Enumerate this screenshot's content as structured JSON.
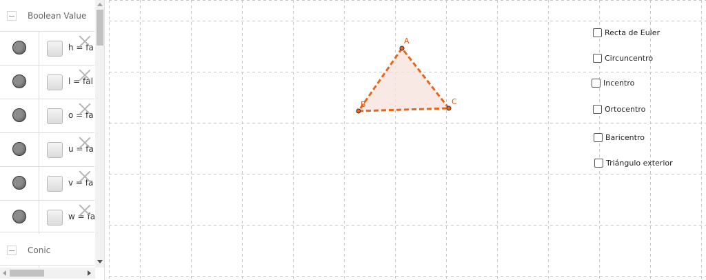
{
  "algebra": {
    "categories": [
      {
        "label": "Boolean Value"
      },
      {
        "label": "Conic"
      }
    ],
    "boolean_rows": [
      {
        "text": "h = fa"
      },
      {
        "text": "l = fal"
      },
      {
        "text": "o = fa"
      },
      {
        "text": "u = fa"
      },
      {
        "text": "v = fa"
      },
      {
        "text": "w = fa"
      }
    ]
  },
  "graphics": {
    "points": [
      {
        "label": "A"
      },
      {
        "label": "B"
      },
      {
        "label": "C"
      }
    ],
    "checkboxes": [
      {
        "label": "Recta de Euler",
        "checked": false
      },
      {
        "label": "Circuncentro",
        "checked": false
      },
      {
        "label": "Incentro",
        "checked": false
      },
      {
        "label": "Ortocentro",
        "checked": false
      },
      {
        "label": "Baricentro",
        "checked": false
      },
      {
        "label": "Triángulo exterior",
        "checked": false
      }
    ],
    "colors": {
      "triangle_stroke": "#e8651a",
      "triangle_fill": "#f6e2dc",
      "label": "#d95f1a",
      "grid": "#c4c4c4"
    }
  }
}
